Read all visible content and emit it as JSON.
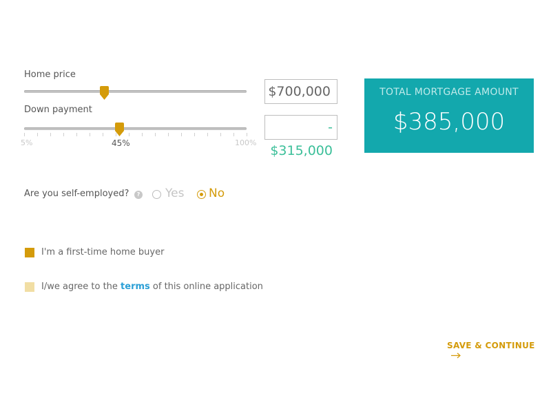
{
  "home_price": {
    "label": "Home price",
    "value": "$700,000",
    "slider_position_fraction": 0.36
  },
  "down_payment": {
    "label": "Down payment",
    "value": "- $315,000",
    "percent": 45,
    "scale_min": "5%",
    "scale_current": "45%",
    "scale_max": "100%"
  },
  "total": {
    "title": "TOTAL MORTGAGE AMOUNT",
    "amount": "$385,000"
  },
  "self_employed": {
    "question": "Are you self-employed?",
    "help_icon": "question-mark-icon",
    "options": [
      {
        "label": "Yes",
        "selected": false
      },
      {
        "label": "No",
        "selected": true
      }
    ]
  },
  "checkboxes": {
    "first_time": {
      "label": "I'm a first-time home buyer",
      "checked": true
    },
    "agree": {
      "prefix": "I/we agree to the ",
      "link": "terms",
      "suffix": " of this online application",
      "checked": false
    }
  },
  "actions": {
    "save_continue": "SAVE & CONTINUE",
    "arrow_icon": "arrow-right-icon"
  },
  "colors": {
    "accent": "#d49b0a",
    "teal": "#13a8ad",
    "green": "#3bbf99",
    "link": "#2a9fd6"
  }
}
